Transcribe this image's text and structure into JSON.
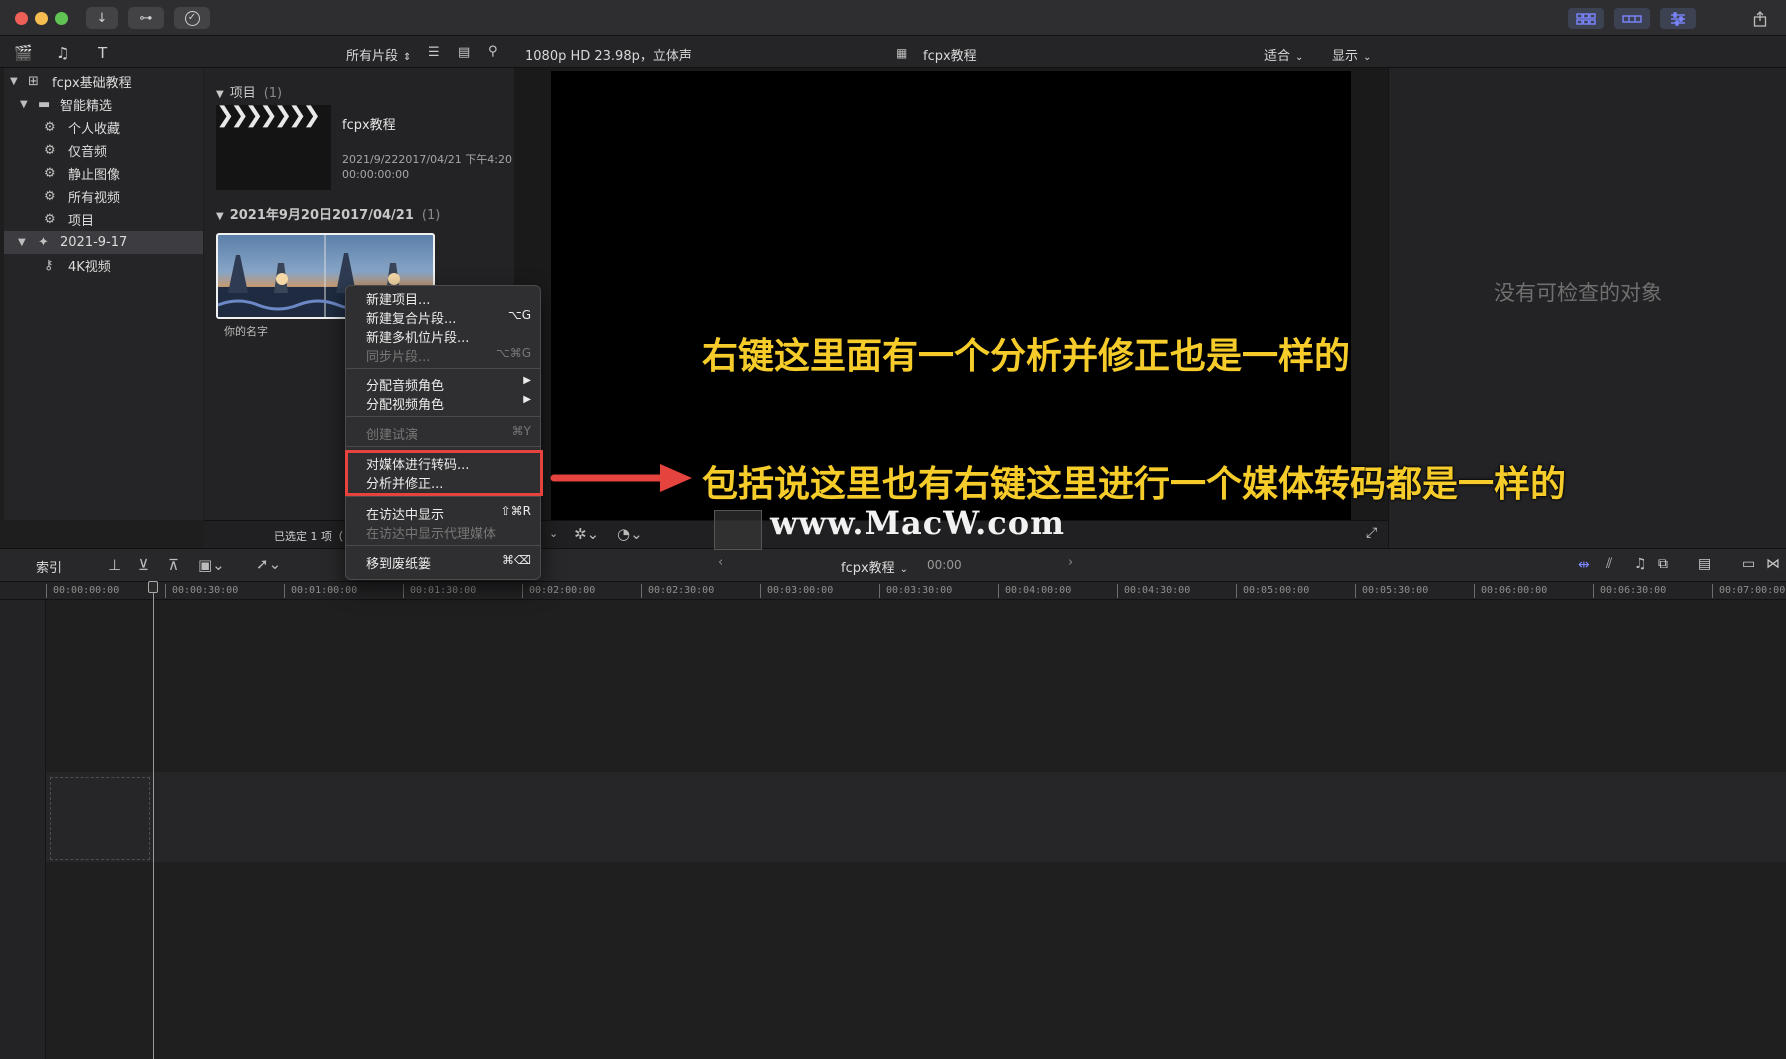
{
  "titlebar": {
    "colors": {
      "close": "#ee5f58",
      "minimize": "#f5bd4f",
      "zoom": "#5fc454"
    },
    "buttons": [
      {
        "icon": "download-icon",
        "glyph": "↓"
      },
      {
        "icon": "key-icon",
        "glyph": "⊶"
      },
      {
        "icon": "checkmark-circle-icon",
        "glyph": "✓"
      }
    ]
  },
  "toolbar": {
    "filter_label": "所有片段",
    "format_info": "1080p HD 23.98p，立体声",
    "project_name": "fcpx教程",
    "zoom_label": "适合",
    "view_label": "显示"
  },
  "sidebar": {
    "library": "fcpx基础教程",
    "smart_collections": "智能精选",
    "items": [
      {
        "label": "个人收藏"
      },
      {
        "label": "仅音频"
      },
      {
        "label": "静止图像"
      },
      {
        "label": "所有视频"
      },
      {
        "label": "项目"
      }
    ],
    "event": "2021-9-17",
    "keyword": "4K视频"
  },
  "browser": {
    "projects_header": "项目",
    "projects_count": "(1)",
    "project": {
      "name": "fcpx教程",
      "date": "2021/9/222017/04/21 下午4:20",
      "duration": "00:00:00:00"
    },
    "event_header": "2021年9月20日2017/04/21",
    "event_count": "(1)",
    "clip_name": "你的名字",
    "selection_status": "已选定 1 项（"
  },
  "viewer": {
    "inspector_empty": "没有可检查的对象"
  },
  "context_menu": {
    "items": [
      {
        "label": "新建项目...",
        "shortcut": ""
      },
      {
        "label": "新建复合片段...",
        "shortcut": "⌥G"
      },
      {
        "label": "新建多机位片段...",
        "shortcut": ""
      },
      {
        "label": "同步片段...",
        "shortcut": "⌥⌘G"
      },
      {
        "label": "分配音频角色",
        "shortcut": "▶"
      },
      {
        "label": "分配视频角色",
        "shortcut": "▶"
      },
      {
        "label": "创建试演",
        "shortcut": "⌘Y"
      },
      {
        "label": "对媒体进行转码...",
        "shortcut": ""
      },
      {
        "label": "分析并修正...",
        "shortcut": ""
      },
      {
        "label": "在访达中显示",
        "shortcut": "⇧⌘R"
      },
      {
        "label": "在访达中显示代理媒体",
        "shortcut": ""
      },
      {
        "label": "移到废纸篓",
        "shortcut": "⌘⌫"
      }
    ]
  },
  "timeline_bar": {
    "index_label": "索引",
    "project_name": "fcpx教程",
    "timecode": "00:00"
  },
  "ruler": {
    "ticks": [
      "00:00:00:00",
      "00:00:30:00",
      "00:01:00:00",
      "00:01:30:00",
      "00:02:00:00",
      "00:02:30:00",
      "00:03:00:00",
      "00:03:30:00",
      "00:04:00:00",
      "00:04:30:00",
      "00:05:00:00",
      "00:05:30:00",
      "00:06:00:00",
      "00:06:30:00",
      "00:07:00:00"
    ]
  },
  "annotations": {
    "line1": "右键这里面有一个分析并修正也是一样的",
    "line2": "包括说这里也有右键这里进行一个媒体转码都是一样的",
    "accent_color": "#f6cc2a",
    "arrow_color": "#e5433d"
  },
  "watermark": "www.MacW.com"
}
